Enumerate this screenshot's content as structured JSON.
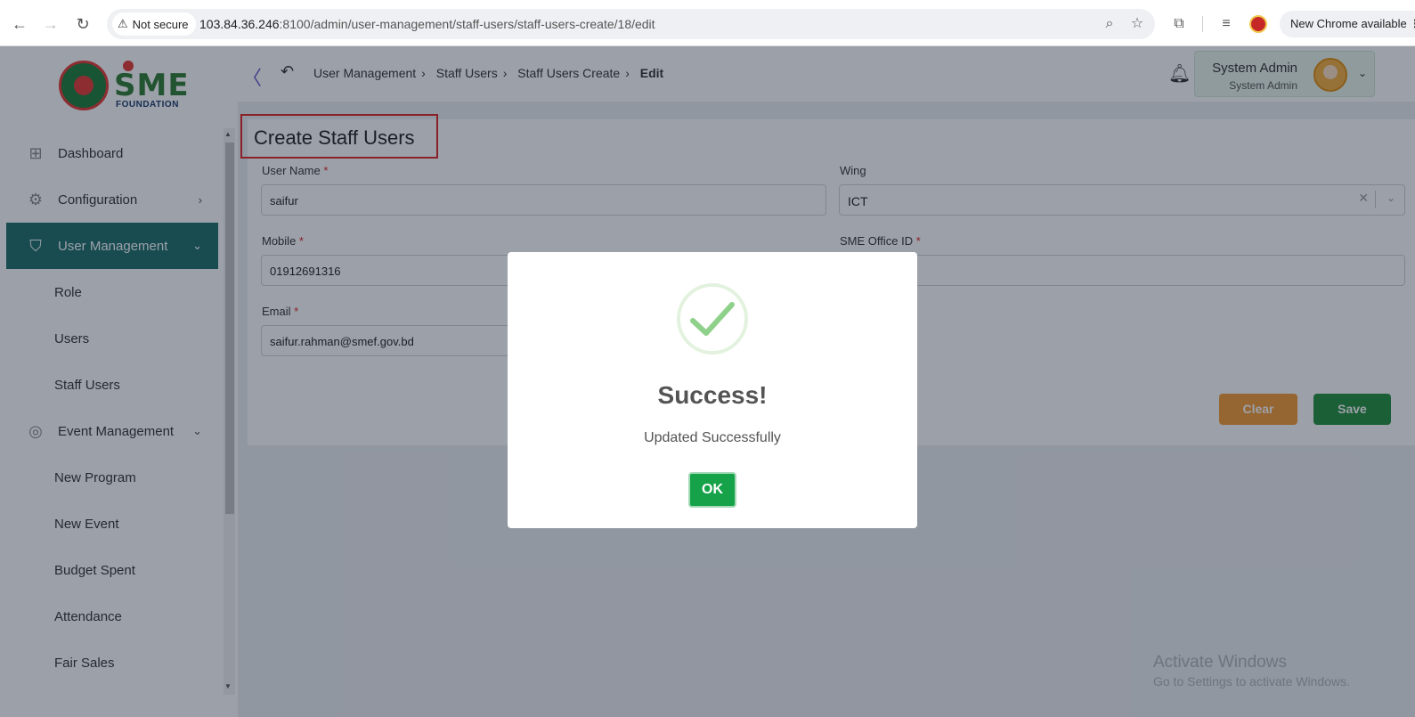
{
  "browser": {
    "security_label": "Not secure",
    "url_host": "103.84.36.246",
    "url_rest": ":8100/admin/user-management/staff-users/staff-users-create/18/edit",
    "update_label": "New Chrome available"
  },
  "logo": {
    "brand": "SME",
    "subtitle": "FOUNDATION"
  },
  "sidebar": {
    "items": [
      {
        "label": "Dashboard"
      },
      {
        "label": "Configuration"
      },
      {
        "label": "User Management"
      },
      {
        "label": "Role"
      },
      {
        "label": "Users"
      },
      {
        "label": "Staff Users"
      },
      {
        "label": "Event Management"
      },
      {
        "label": "New Program"
      },
      {
        "label": "New Event"
      },
      {
        "label": "Budget Spent"
      },
      {
        "label": "Attendance"
      },
      {
        "label": "Fair Sales"
      }
    ]
  },
  "breadcrumb": [
    "User Management",
    "Staff Users",
    "Staff Users Create",
    "Edit"
  ],
  "user": {
    "name": "System Admin",
    "role": "System Admin"
  },
  "form": {
    "title": "Create Staff Users",
    "user_name_label": "User Name",
    "user_name_value": "saifur",
    "wing_label": "Wing",
    "wing_value": "ICT",
    "mobile_label": "Mobile",
    "mobile_value": "01912691316",
    "office_id_label": "SME Office ID",
    "email_label": "Email",
    "email_value": "saifur.rahman@smef.gov.bd",
    "required_mark": "*",
    "clear_label": "Clear",
    "save_label": "Save"
  },
  "modal": {
    "title": "Success!",
    "message": "Updated Successfully",
    "ok_label": "OK"
  },
  "watermark": {
    "line1": "Activate Windows",
    "line2": "Go to Settings to activate Windows."
  }
}
